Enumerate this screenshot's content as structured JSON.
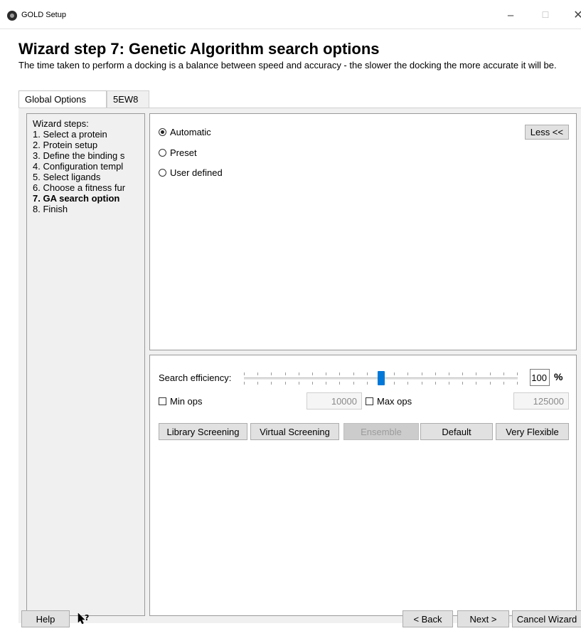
{
  "window": {
    "title": "GOLD Setup",
    "minimize": "–",
    "maximize": "☐",
    "close": "✕"
  },
  "header": {
    "title": "Wizard step 7: Genetic Algorithm search options",
    "description": "The time taken to perform a docking is a balance between speed and accuracy - the slower the docking the more accurate it will be."
  },
  "tabs": [
    {
      "label": "Global Options",
      "active": true
    },
    {
      "label": "5EW8",
      "active": false
    }
  ],
  "sidebar": {
    "heading": "Wizard steps:",
    "steps": [
      "1. Select a protein",
      "2. Protein setup",
      "3. Define the binding s",
      "4. Configuration templ",
      "5. Select ligands",
      "6. Choose a fitness fur",
      "7. GA search option",
      "8. Finish"
    ],
    "current_step_index": 6
  },
  "options": {
    "radios": [
      {
        "label": "Automatic",
        "checked": true
      },
      {
        "label": "Preset",
        "checked": false
      },
      {
        "label": "User defined",
        "checked": false
      }
    ],
    "less_button": "Less <<"
  },
  "search": {
    "efficiency_label": "Search efficiency:",
    "efficiency_value": "100",
    "efficiency_unit": "%",
    "slider_fraction": 0.5,
    "min_ops_label": "Min ops",
    "min_ops_value": "10000",
    "min_ops_checked": false,
    "max_ops_label": "Max ops",
    "max_ops_value": "125000",
    "max_ops_checked": false,
    "presets": [
      {
        "label": "Library Screening",
        "enabled": true
      },
      {
        "label": "Virtual Screening",
        "enabled": true
      },
      {
        "label": "Ensemble",
        "enabled": false
      },
      {
        "label": "Default",
        "enabled": true
      },
      {
        "label": "Very Flexible",
        "enabled": true
      }
    ]
  },
  "footer": {
    "help": "Help",
    "whats_this_icon": "whats-this-icon",
    "back": "< Back",
    "next": "Next >",
    "cancel": "Cancel Wizard"
  },
  "colors": {
    "slider_thumb": "#0078d7",
    "panel_bg": "#f0f0f0",
    "disabled_text": "#9c9c9c"
  }
}
